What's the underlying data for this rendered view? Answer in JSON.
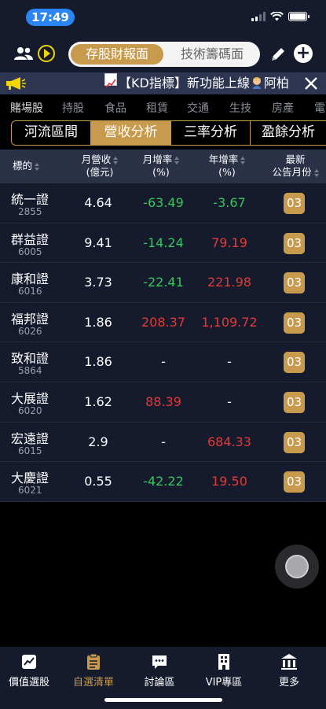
{
  "status": {
    "time": "17:49"
  },
  "topnav": {
    "segment_active": "存股財報面",
    "segment_inactive": "技術籌碼面"
  },
  "announcement": {
    "text": "【KD指標】新功能上線",
    "trail": "阿柏"
  },
  "categories": [
    "賭場股",
    "持股",
    "食品",
    "租賃",
    "交通",
    "生技",
    "房產",
    "電"
  ],
  "tabs": [
    "河流區間",
    "營收分析",
    "三率分析",
    "盈餘分析"
  ],
  "table": {
    "headers": {
      "stock": "標的",
      "revenue": [
        "月營收",
        "(億元)"
      ],
      "mom": [
        "月增率",
        "(%)"
      ],
      "yoy": [
        "年增率",
        "(%)"
      ],
      "latest": [
        "最新",
        "公告月份"
      ]
    },
    "rows": [
      {
        "name": "統一證",
        "code": "2855",
        "revenue": "4.64",
        "mom": "-63.49",
        "mom_color": "green",
        "yoy": "-3.67",
        "yoy_color": "green",
        "month": "03"
      },
      {
        "name": "群益證",
        "code": "6005",
        "revenue": "9.41",
        "mom": "-14.24",
        "mom_color": "green",
        "yoy": "79.19",
        "yoy_color": "red",
        "month": "03"
      },
      {
        "name": "康和證",
        "code": "6016",
        "revenue": "3.73",
        "mom": "-22.41",
        "mom_color": "green",
        "yoy": "221.98",
        "yoy_color": "red",
        "month": "03"
      },
      {
        "name": "福邦證",
        "code": "6026",
        "revenue": "1.86",
        "mom": "208.37",
        "mom_color": "red",
        "yoy": "1,109.72",
        "yoy_color": "red",
        "month": "03"
      },
      {
        "name": "致和證",
        "code": "5864",
        "revenue": "1.86",
        "mom": "-",
        "mom_color": "white",
        "yoy": "-",
        "yoy_color": "white",
        "month": "03"
      },
      {
        "name": "大展證",
        "code": "6020",
        "revenue": "1.62",
        "mom": "88.39",
        "mom_color": "red",
        "yoy": "-",
        "yoy_color": "white",
        "month": "03"
      },
      {
        "name": "宏遠證",
        "code": "6015",
        "revenue": "2.9",
        "mom": "-",
        "mom_color": "white",
        "yoy": "684.33",
        "yoy_color": "red",
        "month": "03"
      },
      {
        "name": "大慶證",
        "code": "6021",
        "revenue": "0.55",
        "mom": "-42.22",
        "mom_color": "green",
        "yoy": "19.50",
        "yoy_color": "red",
        "month": "03"
      }
    ]
  },
  "bottom_nav": [
    {
      "label": "價值選股",
      "icon": "chart-up-icon",
      "active": false
    },
    {
      "label": "自選清單",
      "icon": "clipboard-icon",
      "active": true
    },
    {
      "label": "討論區",
      "icon": "chat-icon",
      "active": false
    },
    {
      "label": "VIP專區",
      "icon": "building-icon",
      "active": false
    },
    {
      "label": "更多",
      "icon": "bank-icon",
      "active": false
    }
  ],
  "colors": {
    "accent": "#c89a4e",
    "background": "#151b2c",
    "up": "#e53935",
    "down": "#34c759"
  }
}
